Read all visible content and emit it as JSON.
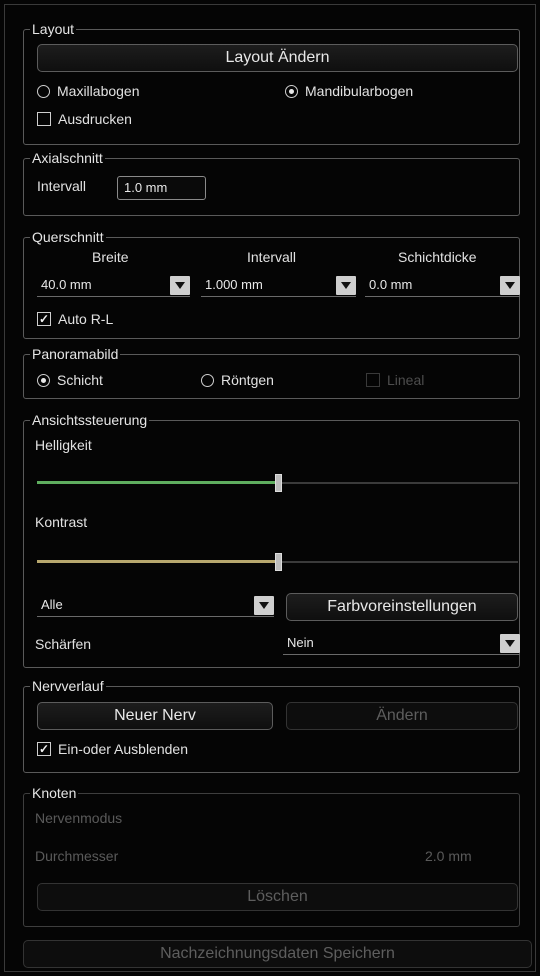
{
  "layout": {
    "title": "Layout",
    "change_button": "Layout Ändern",
    "radio_maxilla": "Maxillabogen",
    "radio_mandibula": "Mandibularbogen",
    "selected": "Mandibularbogen",
    "print_checkbox": "Ausdrucken",
    "print_checked": false
  },
  "axial": {
    "title": "Axialschnitt",
    "interval_label": "Intervall",
    "interval_value": "1.0 mm"
  },
  "cross": {
    "title": "Querschnitt",
    "col_width": "Breite",
    "col_interval": "Intervall",
    "col_thickness": "Schichtdicke",
    "width_value": "40.0 mm",
    "interval_value": "1.000 mm",
    "thickness_value": "0.0 mm",
    "auto_rl": "Auto R-L",
    "auto_rl_checked": true
  },
  "panorama": {
    "title": "Panoramabild",
    "radio_layer": "Schicht",
    "radio_xray": "Röntgen",
    "ruler": "Lineal",
    "selected": "Schicht"
  },
  "view": {
    "title": "Ansichtssteuerung",
    "brightness_label": "Helligkeit",
    "brightness_level": 0.5,
    "brightness_color": "#5fae5f",
    "contrast_label": "Kontrast",
    "contrast_level": 0.5,
    "contrast_color": "#b8a86e",
    "filter_value": "Alle",
    "color_presets_button": "Farbvoreinstellungen",
    "sharpen_label": "Schärfen",
    "sharpen_value": "Nein"
  },
  "nerve": {
    "title": "Nervverlauf",
    "new_button": "Neuer Nerv",
    "change_button": "Ändern",
    "toggle_checkbox": "Ein-oder Ausblenden",
    "toggle_checked": true
  },
  "nodes": {
    "title": "Knoten",
    "mode_label": "Nervenmodus",
    "diameter_label": "Durchmesser",
    "diameter_value": "2.0 mm",
    "delete_button": "Löschen"
  },
  "save_button": "Nachzeichnungsdaten Speichern"
}
